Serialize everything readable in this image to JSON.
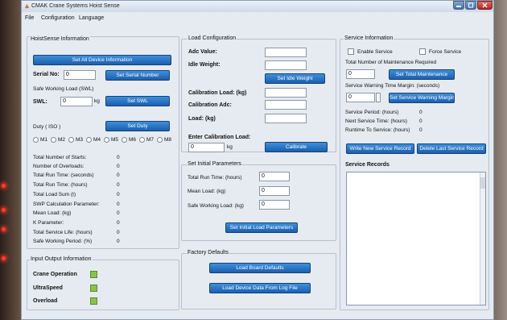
{
  "window": {
    "title": "CMAK Crane Systems Hoist Sense"
  },
  "menu": [
    "File",
    "Configuration",
    "Language"
  ],
  "hoist": {
    "title": "HoistSense Information",
    "set_all_button": "Set All Device Information",
    "serial_label": "Serial No:",
    "serial_value": "0",
    "set_serial_button": "Set Serial Number",
    "swl_caption": "Safe Working Load (SWL)",
    "swl_label": "SWL:",
    "swl_value": "0",
    "swl_unit": "kg",
    "set_swl_button": "Set SWL",
    "duty_label": "Duty ( ISO )",
    "set_duty_button": "Set Duty",
    "duty_options": [
      "M1",
      "M2",
      "M3",
      "M4",
      "M5",
      "M6",
      "M7",
      "M8"
    ],
    "stats": [
      {
        "label": "Total Number of Starts:",
        "value": "0"
      },
      {
        "label": "Number of Overloads:",
        "value": "0"
      },
      {
        "label": "Total Run Time: (seconds)",
        "value": "0"
      },
      {
        "label": "Total Run Time: (hours)",
        "value": "0"
      },
      {
        "label": "Total Load Sum (t)",
        "value": "0"
      },
      {
        "label": "SWP Calculation Parameter:",
        "value": "0"
      },
      {
        "label": "Mean Load: (kg)",
        "value": "0"
      },
      {
        "label": "K Parameter:",
        "value": "0"
      },
      {
        "label": "Total Service Life: (hours)",
        "value": "0"
      },
      {
        "label": "Safe Working Period: (%)",
        "value": "0"
      }
    ]
  },
  "io": {
    "title": "Input Output Information",
    "items": [
      "Crane Operation",
      "UltraSpeed",
      "Overload"
    ]
  },
  "load": {
    "title": "Load Configuration",
    "adc_value_label": "Adc Value:",
    "idle_weight_label": "Idle Weight:",
    "set_idle_button": "Set Idle Weight",
    "cal_load_label": "Calibration Load: (kg)",
    "cal_adc_label": "Calibration Adc:",
    "load_label": "Load: (kg)",
    "enter_cal_label": "Enter Calibration Load:",
    "enter_cal_value": "0",
    "enter_cal_unit": "kg",
    "calibrate_button": "Calibrate"
  },
  "initial": {
    "title": "Set Initial Parameters",
    "run_time_label": "Total Run Time: (hours)",
    "run_time_value": "0",
    "mean_load_label": "Mean Load: (kg)",
    "mean_load_value": "0",
    "swl_label": "Safe Working Load: (kg)",
    "swl_value": "0",
    "set_button": "Set Initial Load Parameters"
  },
  "factory": {
    "title": "Factory Defaults",
    "load_board_button": "Load Board Defaults",
    "load_log_button": "Load Device Data From Log File"
  },
  "service": {
    "title": "Service Information",
    "enable_label": "Enable Service",
    "force_label": "Force Service",
    "total_maint_label": "Total Number of Maintenance Required",
    "total_maint_value": "0",
    "set_total_button": "Set Total Maintenance",
    "warning_label": "Service Warning Time Margin: (seconds)",
    "warning_value": "0",
    "set_warning_button": "Set Service Warning Margin",
    "period_label": "Service Period: (hours)",
    "period_value": "0",
    "next_label": "Next Service Time: (hours)",
    "next_value": "0",
    "runtime_label": "Runtime To Service: (hours)",
    "runtime_value": "0",
    "write_button": "Write New Service Record",
    "delete_button": "Delete Last Service Record",
    "records_label": "Service Records"
  }
}
